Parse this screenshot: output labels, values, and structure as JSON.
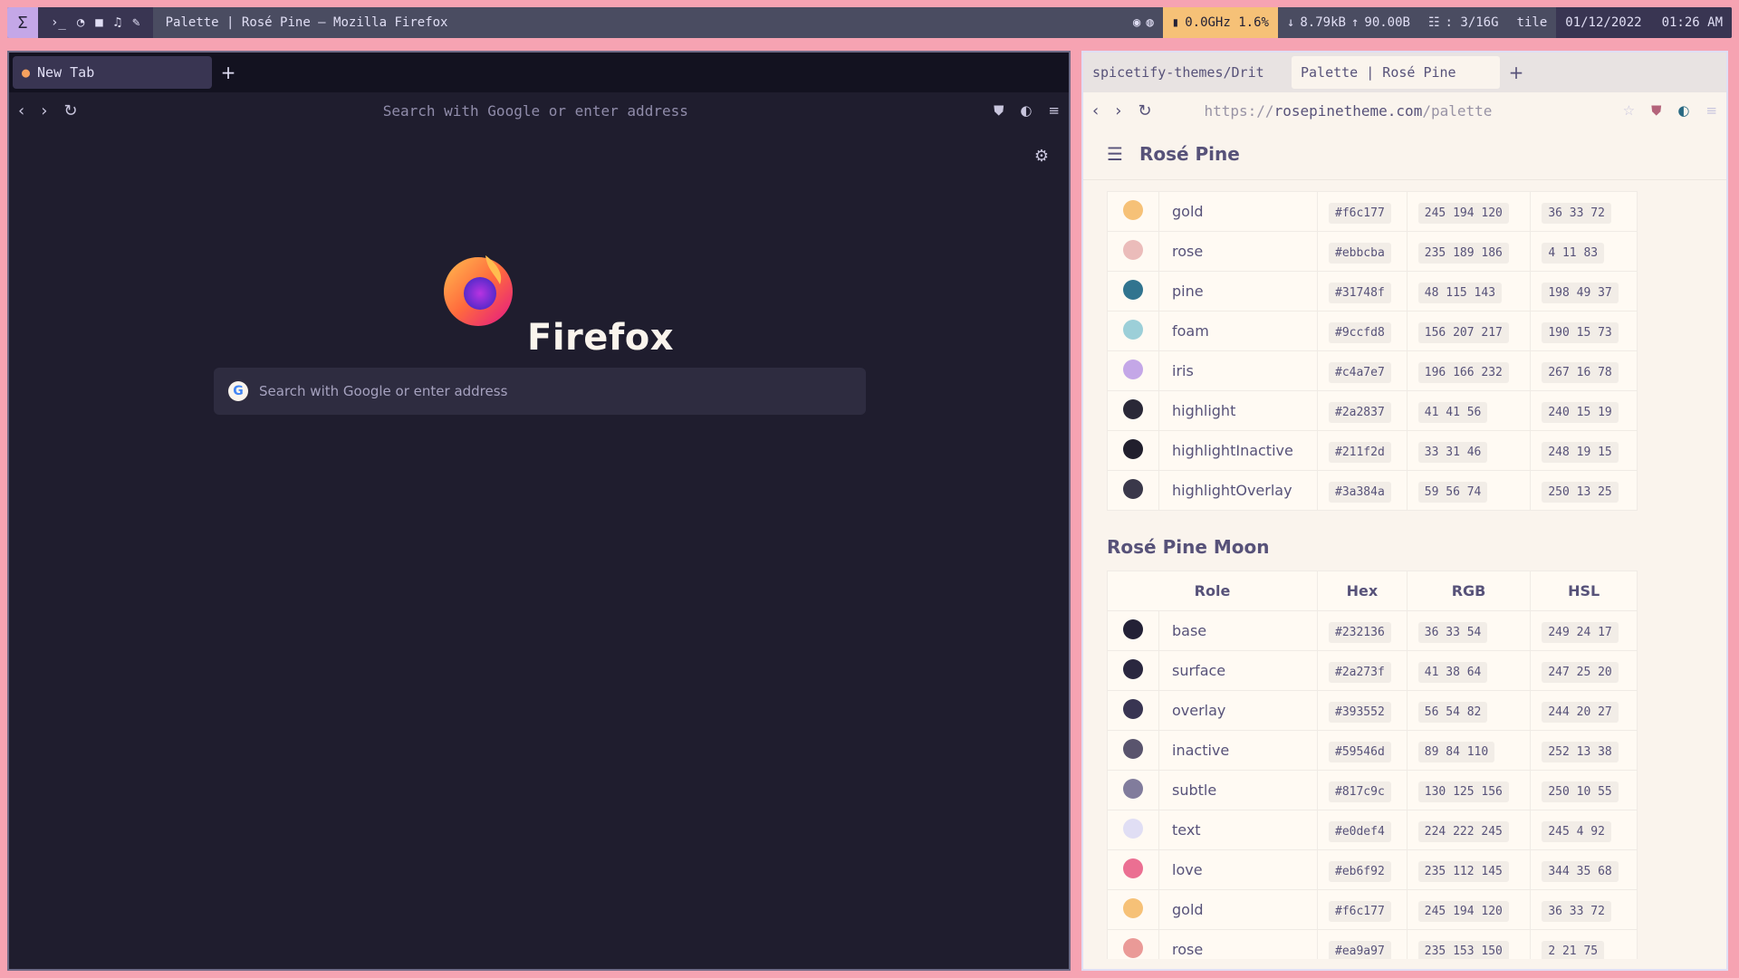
{
  "topbar": {
    "sigma": "Σ",
    "icons": [
      "terminal-icon",
      "firefox-icon",
      "video-icon",
      "music-icon",
      "brush-icon"
    ],
    "icon_glyphs": [
      "›_",
      "◔",
      "■",
      "♫",
      "✎"
    ],
    "window_title": "Palette | Rosé Pine — Mozilla Firefox",
    "cpu": "0.0GHz 1.6%",
    "net_down": "8.79kB",
    "net_up": "90.00B",
    "mem": ": 3/16G",
    "layout": "tile",
    "date": "01/12/2022",
    "time": "01:26 AM"
  },
  "left_window": {
    "tab_label": "New Tab",
    "urlbar_placeholder": "Search with Google or enter address",
    "brand": "Firefox",
    "search_placeholder": "Search with Google or enter address"
  },
  "right_window": {
    "tabs": [
      "spicetify-themes/Drit",
      "Palette | Rosé Pine"
    ],
    "url_prefix": "https://",
    "url_host": "rosepinetheme.com",
    "url_path": "/palette",
    "site_title": "Rosé Pine",
    "table_top": [
      {
        "role": "gold",
        "hex": "#f6c177",
        "rgb": "245 194 120",
        "hsl": "36 33 72",
        "color": "#f6c177"
      },
      {
        "role": "rose",
        "hex": "#ebbcba",
        "rgb": "235 189 186",
        "hsl": "4 11 83",
        "color": "#ebbcba"
      },
      {
        "role": "pine",
        "hex": "#31748f",
        "rgb": "48 115 143",
        "hsl": "198 49 37",
        "color": "#31748f"
      },
      {
        "role": "foam",
        "hex": "#9ccfd8",
        "rgb": "156 207 217",
        "hsl": "190 15 73",
        "color": "#9ccfd8"
      },
      {
        "role": "iris",
        "hex": "#c4a7e7",
        "rgb": "196 166 232",
        "hsl": "267 16 78",
        "color": "#c4a7e7"
      },
      {
        "role": "highlight",
        "hex": "#2a2837",
        "rgb": "41 41 56",
        "hsl": "240 15 19",
        "color": "#2a2837"
      },
      {
        "role": "highlightInactive",
        "hex": "#211f2d",
        "rgb": "33 31 46",
        "hsl": "248 19 15",
        "color": "#211f2d"
      },
      {
        "role": "highlightOverlay",
        "hex": "#3a384a",
        "rgb": "59 56 74",
        "hsl": "250 13 25",
        "color": "#3a384a"
      }
    ],
    "moon_title": "Rosé Pine Moon",
    "headers": {
      "role": "Role",
      "hex": "Hex",
      "rgb": "RGB",
      "hsl": "HSL"
    },
    "table_moon": [
      {
        "role": "base",
        "hex": "#232136",
        "rgb": "36 33 54",
        "hsl": "249 24 17",
        "color": "#232136"
      },
      {
        "role": "surface",
        "hex": "#2a273f",
        "rgb": "41 38 64",
        "hsl": "247 25 20",
        "color": "#2a273f"
      },
      {
        "role": "overlay",
        "hex": "#393552",
        "rgb": "56 54 82",
        "hsl": "244 20 27",
        "color": "#393552"
      },
      {
        "role": "inactive",
        "hex": "#59546d",
        "rgb": "89 84 110",
        "hsl": "252 13 38",
        "color": "#59546d"
      },
      {
        "role": "subtle",
        "hex": "#817c9c",
        "rgb": "130 125 156",
        "hsl": "250 10 55",
        "color": "#817c9c"
      },
      {
        "role": "text",
        "hex": "#e0def4",
        "rgb": "224 222 245",
        "hsl": "245 4 92",
        "color": "#e0def4"
      },
      {
        "role": "love",
        "hex": "#eb6f92",
        "rgb": "235 112 145",
        "hsl": "344 35 68",
        "color": "#eb6f92"
      },
      {
        "role": "gold",
        "hex": "#f6c177",
        "rgb": "245 194 120",
        "hsl": "36 33 72",
        "color": "#f6c177"
      },
      {
        "role": "rose",
        "hex": "#ea9a97",
        "rgb": "235 153 150",
        "hsl": "2 21 75",
        "color": "#ea9a97"
      }
    ]
  }
}
